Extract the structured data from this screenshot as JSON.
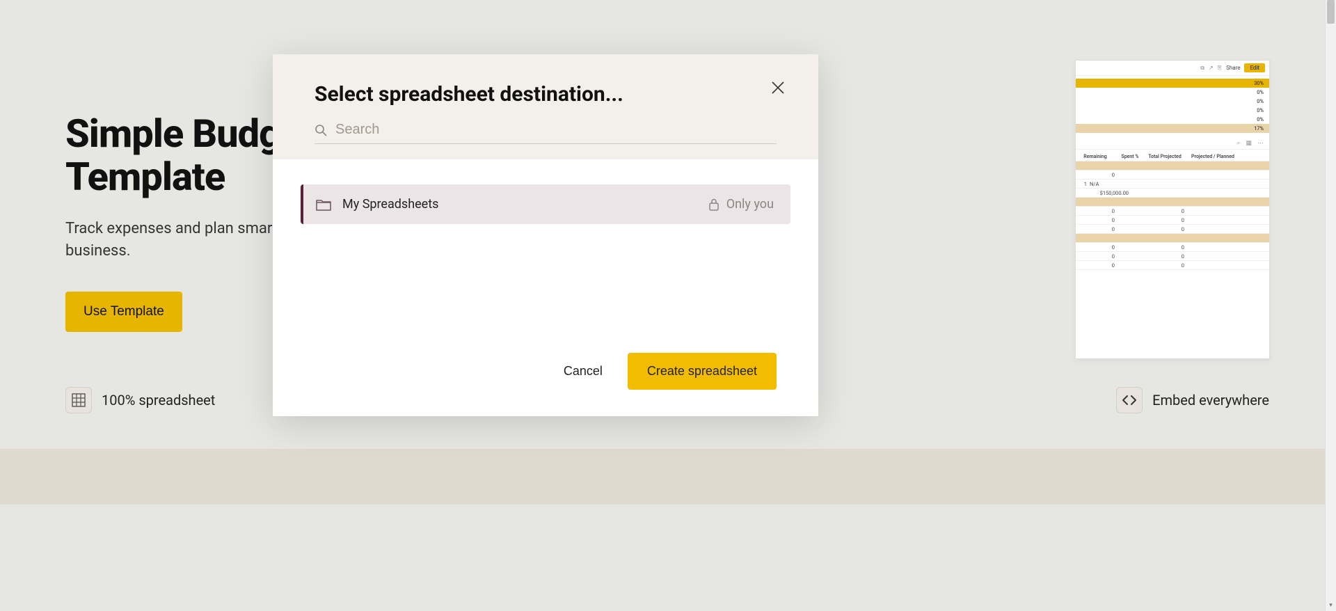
{
  "hero": {
    "title_line1": "Simple Budget",
    "title_line2": "Template",
    "subtitle": "Track expenses and plan smarter for your\nbusiness.",
    "use_template_label": "Use Template"
  },
  "features": {
    "left_label": "100% spreadsheet",
    "right_label": "Embed everywhere"
  },
  "sheet_preview": {
    "toolbar": {
      "share": "Share",
      "edit": "Edit"
    },
    "pct_rows": [
      "30%",
      "0%",
      "0%",
      "0%",
      "0%",
      "17%"
    ],
    "headers": [
      "Remaining",
      "Spent %",
      "Total Projected",
      "Projected / Planned"
    ],
    "rows": [
      {
        "c1": "0",
        "c2": "",
        "c3": "",
        "c4": ""
      },
      {
        "c1": "1",
        "c2": "N/A",
        "c3": "",
        "c4": ""
      },
      {
        "c1": "",
        "c2": "$150,000.00",
        "c3": "",
        "c4": ""
      },
      {
        "c1": "0",
        "c2": "",
        "c3": "0",
        "c4": ""
      },
      {
        "c1": "0",
        "c2": "",
        "c3": "0",
        "c4": ""
      },
      {
        "c1": "0",
        "c2": "",
        "c3": "0",
        "c4": ""
      },
      {
        "c1": "0",
        "c2": "",
        "c3": "0",
        "c4": ""
      },
      {
        "c1": "0",
        "c2": "",
        "c3": "0",
        "c4": ""
      },
      {
        "c1": "0",
        "c2": "",
        "c3": "0",
        "c4": ""
      }
    ]
  },
  "modal": {
    "title": "Select spreadsheet destination...",
    "search_placeholder": "Search",
    "destination": {
      "name": "My Spreadsheets",
      "privacy": "Only you"
    },
    "cancel_label": "Cancel",
    "create_label": "Create spreadsheet"
  }
}
